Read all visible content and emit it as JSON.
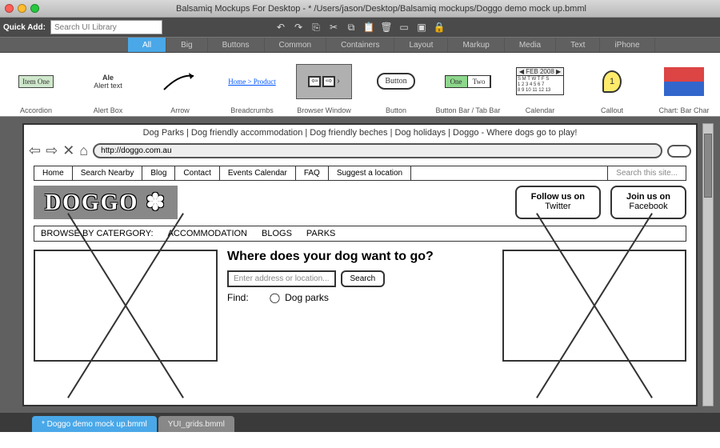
{
  "window": {
    "title": "Balsamiq Mockups For Desktop - * /Users/jason/Desktop/Balsamiq mockups/Doggo demo mock up.bmml"
  },
  "quickbar": {
    "label": "Quick Add:",
    "search_placeholder": "Search UI Library"
  },
  "categories": [
    "All",
    "Big",
    "Buttons",
    "Common",
    "Containers",
    "Layout",
    "Markup",
    "Media",
    "Text",
    "iPhone"
  ],
  "library": {
    "accordion": {
      "label": "Accordion",
      "item": "Item One"
    },
    "alertbox": {
      "label": "Alert Box",
      "title": "Ale",
      "text": "Alert text"
    },
    "arrow": {
      "label": "Arrow"
    },
    "breadcrumbs": {
      "label": "Breadcrumbs",
      "links": "Home > Product"
    },
    "browser": {
      "label": "Browser Window"
    },
    "button": {
      "label": "Button",
      "text": "Button"
    },
    "buttonbar": {
      "label": "Button Bar / Tab Bar",
      "one": "One",
      "two": "Two"
    },
    "calendar": {
      "label": "Calendar",
      "header": "◀ FEB 2008 ▶"
    },
    "callout": {
      "label": "Callout",
      "num": "1"
    },
    "chart": {
      "label": "Chart: Bar Char"
    }
  },
  "mock": {
    "tagline": "Dog Parks | Dog friendly accommodation | Dog friendly beches | Dog holidays | Doggo - Where dogs go to play!",
    "url": "http://doggo.com.au",
    "nav": [
      "Home",
      "Search Nearby",
      "Blog",
      "Contact",
      "Events Calendar",
      "FAQ",
      "Suggest a location"
    ],
    "search_placeholder": "Search this site...",
    "logo": "DOGGO ✽",
    "follow": {
      "line1": "Follow us on",
      "line2": "Twitter"
    },
    "join": {
      "line1": "Join us on",
      "line2": "Facebook"
    },
    "browse_label": "BROWSE BY CATERGORY:",
    "browse_items": [
      "ACCOMMODATION",
      "BLOGS",
      "PARKS"
    ],
    "headline": "Where does your dog want to go?",
    "addr_placeholder": "Enter address or location...",
    "search_btn": "Search",
    "find_label": "Find:",
    "find_opt1": "Dog parks"
  },
  "filetabs": {
    "active": "* Doggo demo mock up.bmml",
    "inactive": "YUI_grids.bmml"
  }
}
